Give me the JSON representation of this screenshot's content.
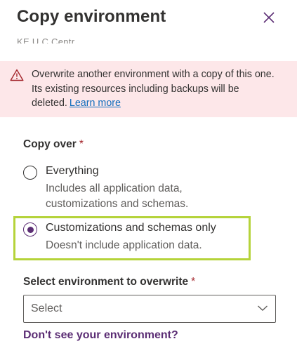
{
  "panel": {
    "title": "Copy environment",
    "subtitle_cut": "KE U C Centr"
  },
  "warning": {
    "text": "Overwrite another environment with a copy of this one. Its existing resources including backups will be deleted.",
    "link": "Learn more",
    "color": "#fde7e9"
  },
  "copy_over": {
    "label": "Copy over",
    "required_mark": "*",
    "options": [
      {
        "title": "Everything",
        "description": "Includes all application data, customizations and schemas.",
        "selected": false
      },
      {
        "title": "Customizations and schemas only",
        "description": "Doesn't include application data.",
        "selected": true
      }
    ]
  },
  "target": {
    "label": "Select environment to overwrite",
    "required_mark": "*",
    "dropdown_value": "Select"
  },
  "help_link": "Don't see your environment?",
  "colors": {
    "accent": "#5b2d74",
    "highlight_border": "#b5d33a",
    "required": "#a4262c",
    "link": "#0f6cbd"
  }
}
